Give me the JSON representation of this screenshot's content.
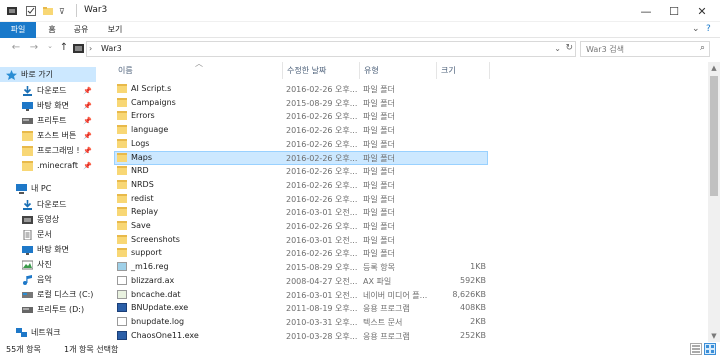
{
  "window": {
    "title": "War3",
    "controls": {
      "minimize": "—",
      "maximize": "☐",
      "close": "✕"
    }
  },
  "ribbon": {
    "tabs": [
      "파일",
      "홈",
      "공유",
      "보기"
    ],
    "collapse_icon": "⌄",
    "help_icon": "?"
  },
  "address": {
    "back": "←",
    "forward": "→",
    "recent": "⌄",
    "up": "↑",
    "path": "War3",
    "search_placeholder": "War3 검색"
  },
  "sidebar": {
    "items": [
      {
        "label": "바로 가기",
        "icon": "star-icon",
        "pinned": false,
        "selected": true
      },
      {
        "label": "다운로드",
        "icon": "download-icon",
        "pinned": true
      },
      {
        "label": "바탕 화면",
        "icon": "desktop-icon",
        "pinned": true
      },
      {
        "label": "프리투트",
        "icon": "drive-icon",
        "pinned": true
      },
      {
        "label": "포스트 버튼",
        "icon": "folder-icon",
        "pinned": true
      },
      {
        "label": "프로그래밍 !",
        "icon": "folder-icon",
        "pinned": true
      },
      {
        "label": ".minecraft",
        "icon": "folder-icon",
        "pinned": true
      },
      {
        "label": "내 PC",
        "icon": "pc-icon"
      },
      {
        "label": "다운로드",
        "icon": "download-icon"
      },
      {
        "label": "동영상",
        "icon": "video-icon"
      },
      {
        "label": "문서",
        "icon": "document-icon"
      },
      {
        "label": "바탕 화면",
        "icon": "desktop-icon"
      },
      {
        "label": "사진",
        "icon": "picture-icon"
      },
      {
        "label": "음악",
        "icon": "music-icon"
      },
      {
        "label": "로컬 디스크 (C:)",
        "icon": "disk-icon"
      },
      {
        "label": "프리투트 (D:)",
        "icon": "drive-icon"
      },
      {
        "label": "네트워크",
        "icon": "network-icon"
      }
    ]
  },
  "columns": {
    "name": "이름",
    "date": "수정한 날짜",
    "type": "유형",
    "size": "크기"
  },
  "files": [
    {
      "name": "AI Script.s",
      "date": "2016-02-26 오후...",
      "type": "파일 폴더",
      "size": "",
      "kind": "folder"
    },
    {
      "name": "Campaigns",
      "date": "2015-08-29 오후...",
      "type": "파일 폴더",
      "size": "",
      "kind": "folder"
    },
    {
      "name": "Errors",
      "date": "2016-02-26 오후...",
      "type": "파일 폴더",
      "size": "",
      "kind": "folder"
    },
    {
      "name": "language",
      "date": "2016-02-26 오후...",
      "type": "파일 폴더",
      "size": "",
      "kind": "folder"
    },
    {
      "name": "Logs",
      "date": "2016-02-26 오후...",
      "type": "파일 폴더",
      "size": "",
      "kind": "folder"
    },
    {
      "name": "Maps",
      "date": "2016-02-26 오후...",
      "type": "파일 폴더",
      "size": "",
      "kind": "folder",
      "selected": true
    },
    {
      "name": "NRD",
      "date": "2016-02-26 오후...",
      "type": "파일 폴더",
      "size": "",
      "kind": "folder"
    },
    {
      "name": "NRDS",
      "date": "2016-02-26 오후...",
      "type": "파일 폴더",
      "size": "",
      "kind": "folder"
    },
    {
      "name": "redist",
      "date": "2016-02-26 오후...",
      "type": "파일 폴더",
      "size": "",
      "kind": "folder"
    },
    {
      "name": "Replay",
      "date": "2016-03-01 오전...",
      "type": "파일 폴더",
      "size": "",
      "kind": "folder"
    },
    {
      "name": "Save",
      "date": "2016-02-26 오후...",
      "type": "파일 폴더",
      "size": "",
      "kind": "folder"
    },
    {
      "name": "Screenshots",
      "date": "2016-03-01 오전...",
      "type": "파일 폴더",
      "size": "",
      "kind": "folder"
    },
    {
      "name": "support",
      "date": "2016-02-26 오후...",
      "type": "파일 폴더",
      "size": "",
      "kind": "folder"
    },
    {
      "name": "_m16.reg",
      "date": "2015-08-29 오후...",
      "type": "등록 항목",
      "size": "1KB",
      "kind": "reg"
    },
    {
      "name": "blizzard.ax",
      "date": "2008-04-27 오전...",
      "type": "AX 파일",
      "size": "592KB",
      "kind": "doc"
    },
    {
      "name": "bncache.dat",
      "date": "2016-03-01 오전...",
      "type": "네이버 미디어 플...",
      "size": "8,626KB",
      "kind": "media"
    },
    {
      "name": "BNUpdate.exe",
      "date": "2011-08-19 오후...",
      "type": "응용 프로그램",
      "size": "408KB",
      "kind": "exe"
    },
    {
      "name": "bnupdate.log",
      "date": "2010-03-31 오후...",
      "type": "텍스트 문서",
      "size": "2KB",
      "kind": "doc"
    },
    {
      "name": "ChaosOne11.exe",
      "date": "2010-03-28 오후...",
      "type": "응용 프로그램",
      "size": "252KB",
      "kind": "exe"
    }
  ],
  "status": {
    "count": "55개 항목",
    "selected": "1개 항목 선택함"
  },
  "colors": {
    "accent": "#1979ca",
    "selection": "#cce8ff",
    "folder": "#f8d775"
  }
}
